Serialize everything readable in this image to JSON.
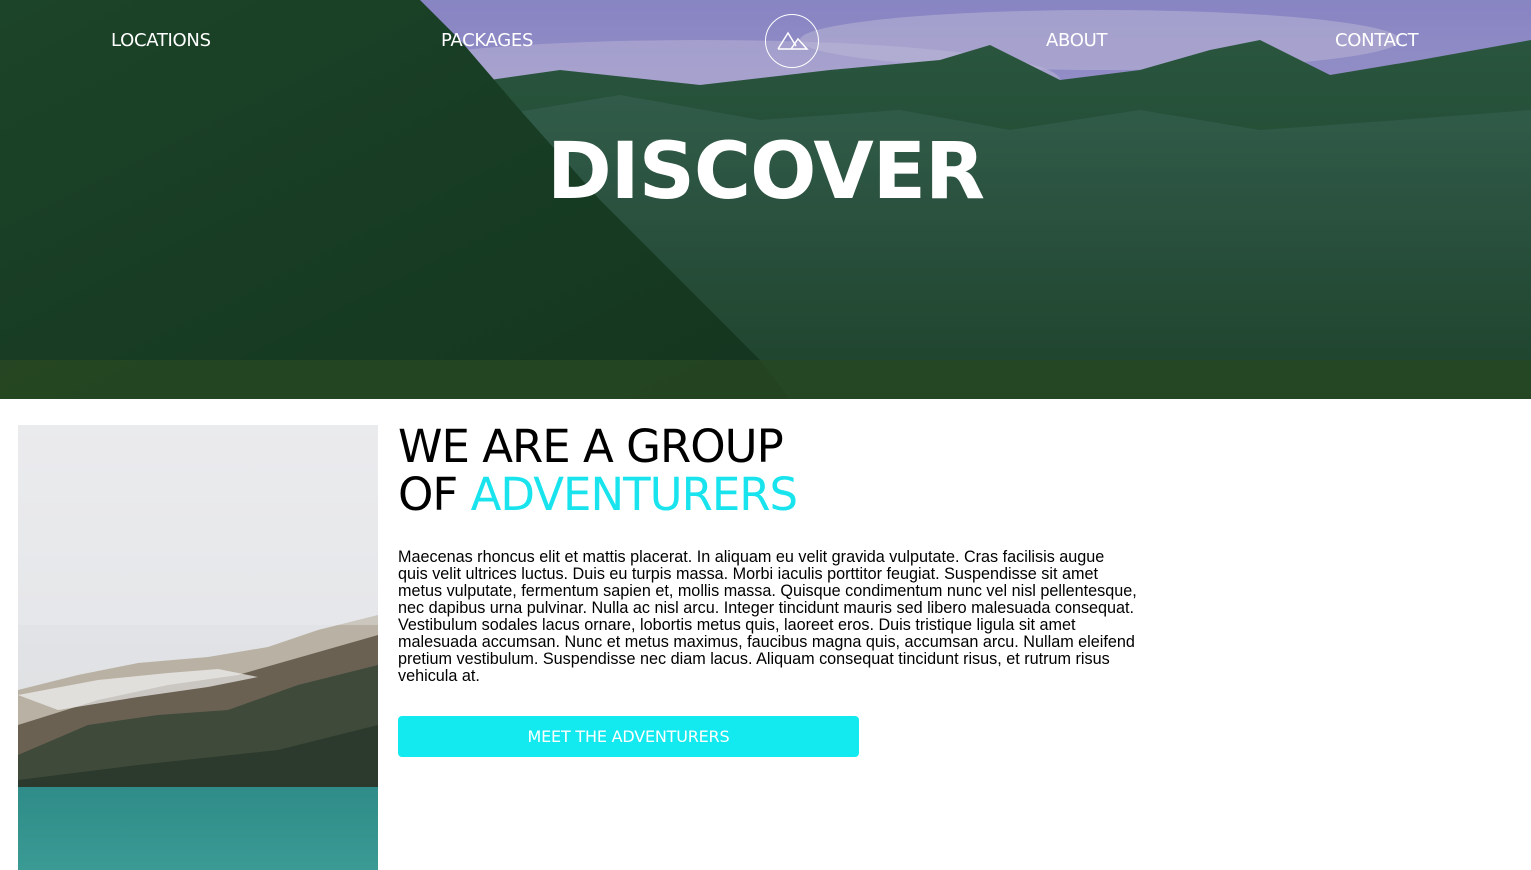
{
  "nav": {
    "items": [
      {
        "label": "LOCATIONS"
      },
      {
        "label": "PACKAGES"
      },
      {
        "label": "ABOUT"
      },
      {
        "label": "CONTACT"
      }
    ],
    "logo_icon": "mountain-logo-icon"
  },
  "hero": {
    "title": "DISCOVER"
  },
  "about": {
    "headline_line1": "WE ARE A GROUP",
    "headline_line2_prefix": "OF",
    "headline_line2_accent": "ADVENTURERS",
    "body": "Maecenas rhoncus elit et mattis placerat. In aliquam eu velit gravida vulputate. Cras facilisis augue quis velit ultrices luctus. Duis eu turpis massa. Morbi iaculis porttitor feugiat. Suspendisse sit amet metus vulputate, fermentum sapien et, mollis massa. Quisque condimentum nunc vel nisl pellentesque, nec dapibus urna pulvinar. Nulla ac nisl arcu. Integer tincidunt mauris sed libero malesuada consequat. Vestibulum sodales lacus ornare, lobortis metus quis, laoreet eros. Duis tristique ligula sit amet malesuada accumsan. Nunc et metus maximus, faucibus magna quis, accumsan arcu. Nullam eleifend pretium vestibulum. Suspendisse nec diam lacus. Aliquam consequat tincidunt risus, et rutrum risus vehicula at.",
    "cta_label": "MEET THE ADVENTURERS"
  },
  "colors": {
    "accent": "#19e4ee",
    "button": "#12eaf0",
    "text": "#000000",
    "hero_text": "#ffffff"
  }
}
